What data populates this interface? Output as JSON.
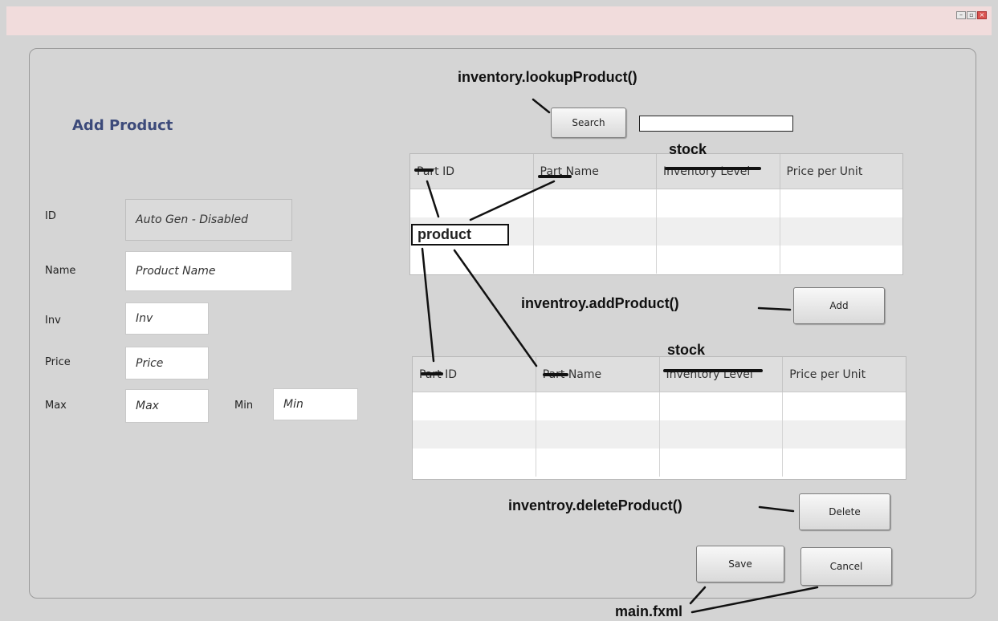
{
  "window": {
    "controls": {
      "minimize": "–",
      "maximize": "▫",
      "close": "×"
    }
  },
  "form": {
    "title": "Add Product",
    "fields": {
      "id": {
        "label": "ID",
        "value": "Auto Gen - Disabled"
      },
      "name": {
        "label": "Name",
        "placeholder": "Product Name"
      },
      "inv": {
        "label": "Inv",
        "placeholder": "Inv"
      },
      "price": {
        "label": "Price",
        "placeholder": "Price"
      },
      "max": {
        "label": "Max",
        "placeholder": "Max"
      },
      "min": {
        "label": "Min",
        "placeholder": "Min"
      }
    }
  },
  "search": {
    "button_label": "Search",
    "value": ""
  },
  "top_table": {
    "columns": [
      "Part ID",
      "Part Name",
      "Inventory Level",
      "Price per Unit"
    ]
  },
  "bottom_table": {
    "columns": [
      "Part ID",
      "Part Name",
      "Inventory Level",
      "Price per Unit"
    ]
  },
  "buttons": {
    "add": "Add",
    "delete": "Delete",
    "save": "Save",
    "cancel": "Cancel"
  },
  "annotations": {
    "lookup": "inventory.lookupProduct()",
    "add": "inventroy.addProduct()",
    "delete": "inventroy.deleteProduct()",
    "main": "main.fxml",
    "product": "product",
    "stock_top": "stock",
    "stock_bottom": "stock"
  }
}
